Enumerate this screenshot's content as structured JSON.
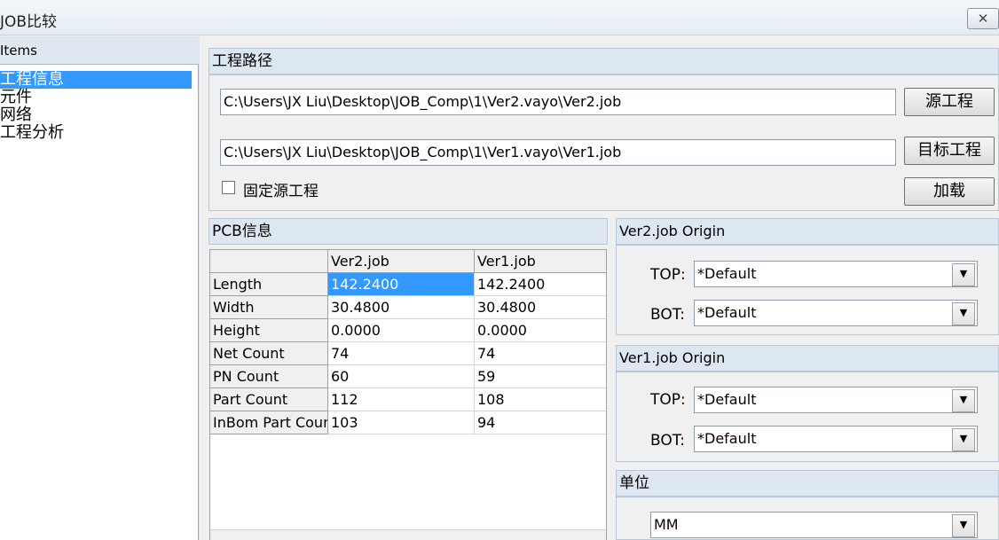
{
  "window": {
    "title": "JOB比较",
    "close_glyph": "✕"
  },
  "sidebar": {
    "header": "Items",
    "items": [
      {
        "label": "工程信息",
        "selected": true
      },
      {
        "label": "元件",
        "selected": false
      },
      {
        "label": "网络",
        "selected": false
      },
      {
        "label": "工程分析",
        "selected": false
      }
    ]
  },
  "project_path": {
    "header": "工程路径",
    "source_path": "C:\\Users\\JX Liu\\Desktop\\JOB_Comp\\1\\Ver2.vayo\\Ver2.job",
    "source_button": "源工程",
    "target_path": "C:\\Users\\JX Liu\\Desktop\\JOB_Comp\\1\\Ver1.vayo\\Ver1.job",
    "target_button": "目标工程",
    "fix_source_label": "固定源工程",
    "fix_source_checked": false,
    "load_button": "加载"
  },
  "pcb_info": {
    "header": "PCB信息",
    "columns": [
      "",
      "Ver2.job",
      "Ver1.job"
    ],
    "rows": [
      {
        "name": "Length",
        "v2": "142.2400",
        "v1": "142.2400"
      },
      {
        "name": "Width",
        "v2": "30.4800",
        "v1": "30.4800"
      },
      {
        "name": "Height",
        "v2": "0.0000",
        "v1": "0.0000"
      },
      {
        "name": "Net Count",
        "v2": "74",
        "v1": "74"
      },
      {
        "name": "PN Count",
        "v2": "60",
        "v1": "59"
      },
      {
        "name": "Part Count",
        "v2": "112",
        "v1": "108"
      },
      {
        "name": "InBom Part Count",
        "v2": "103",
        "v1": "94"
      }
    ]
  },
  "ver2_origin": {
    "header": "Ver2.job Origin",
    "top_label": "TOP:",
    "top_value": "*Default",
    "bot_label": "BOT:",
    "bot_value": "*Default"
  },
  "ver1_origin": {
    "header": "Ver1.job Origin",
    "top_label": "TOP:",
    "top_value": "*Default",
    "bot_label": "BOT:",
    "bot_value": "*Default"
  },
  "unit": {
    "header": "单位",
    "value": "MM"
  },
  "icons": {
    "dropdown": "chevron-down-icon",
    "close": "close-icon"
  },
  "colors": {
    "selection": "#3399ff",
    "header_bg": "#dde7f2"
  }
}
